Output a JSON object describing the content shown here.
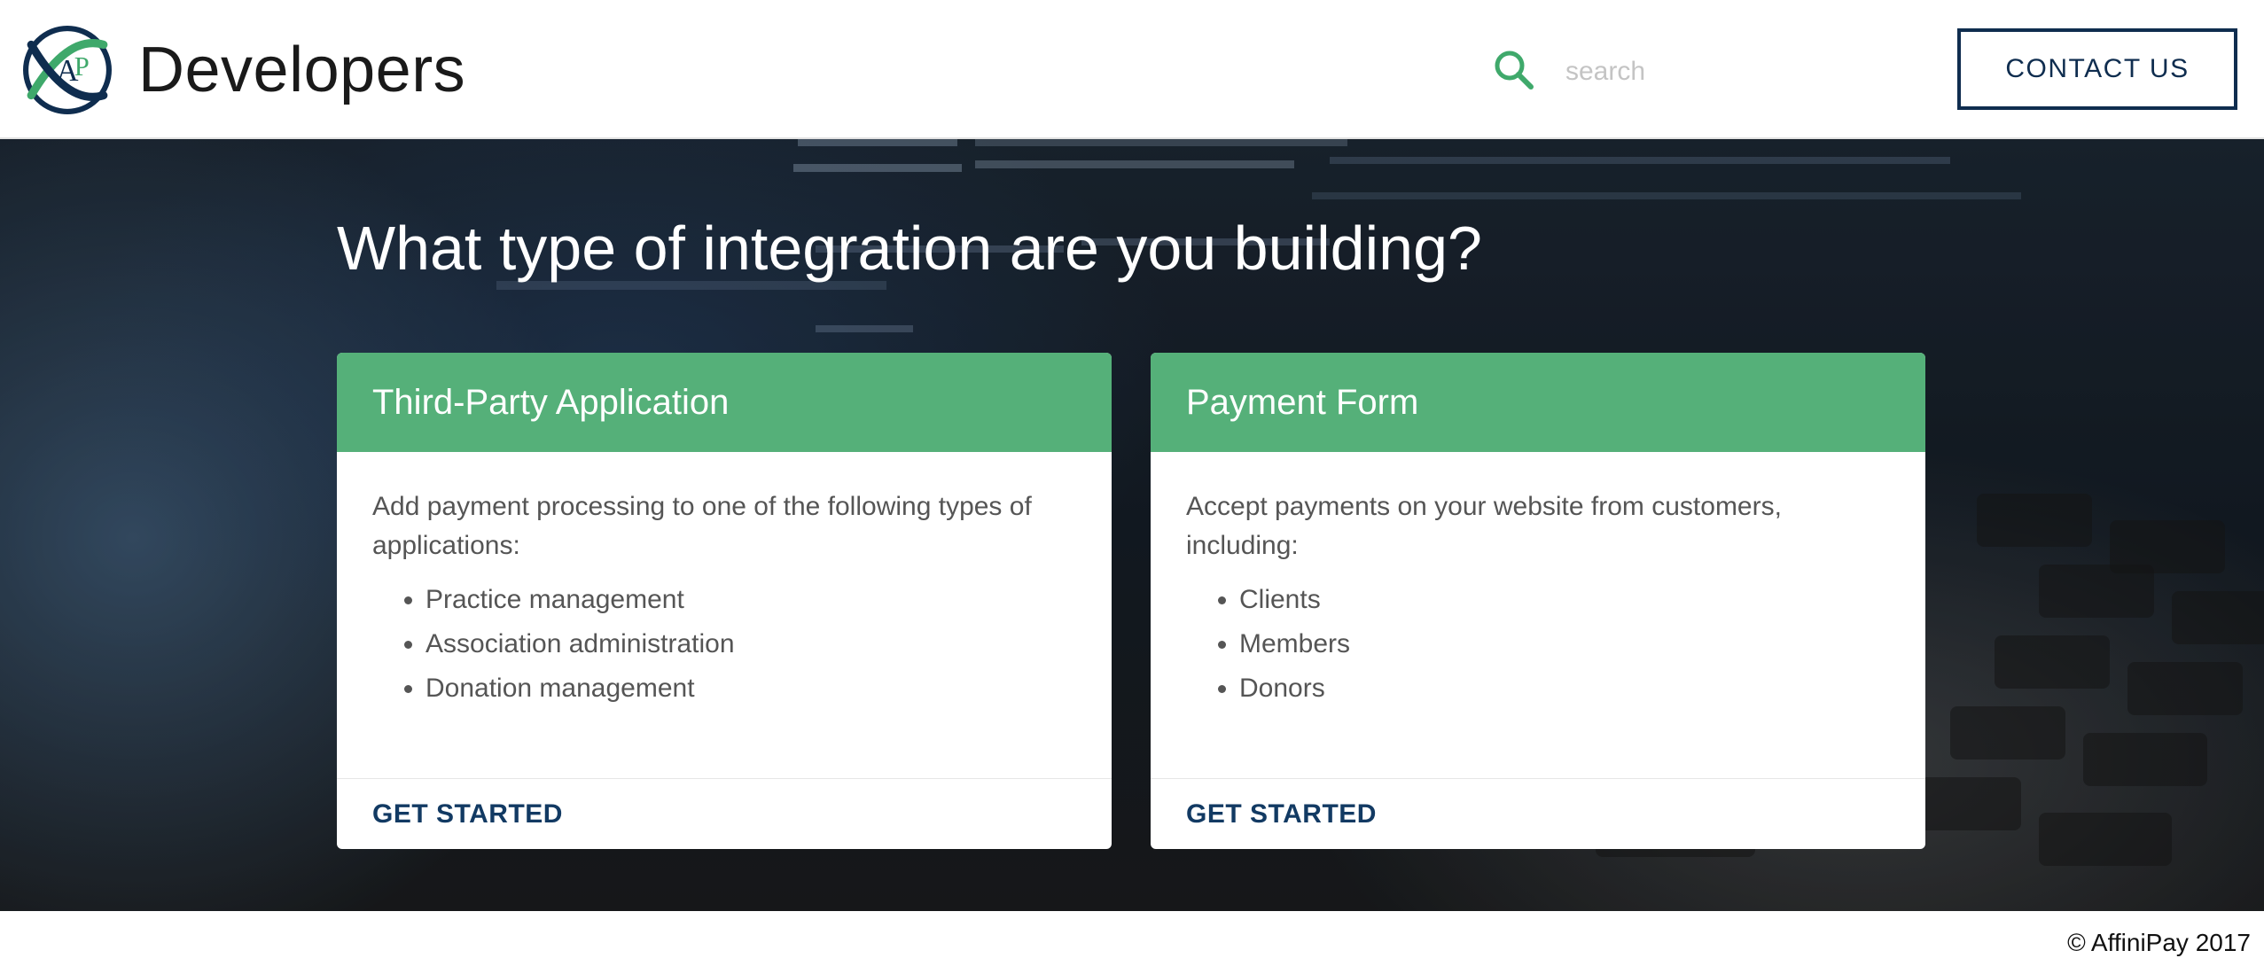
{
  "header": {
    "logo_icon": "affinipay-logo-icon",
    "brand": "Developers",
    "search": {
      "icon": "search-icon",
      "placeholder": "search",
      "value": ""
    },
    "contact_button": "CONTACT US"
  },
  "hero": {
    "title": "What type of integration are you building?",
    "cards": [
      {
        "title": "Third-Party Application",
        "description": "Add payment processing to one of the following types of applications:",
        "items": [
          "Practice management",
          "Association administration",
          "Donation management"
        ],
        "cta": "GET STARTED"
      },
      {
        "title": "Payment Form",
        "description": "Accept payments on your website from customers, including:",
        "items": [
          "Clients",
          "Members",
          "Donors"
        ],
        "cta": "GET STARTED"
      }
    ]
  },
  "footer": {
    "copyright": "© AffiniPay 2017"
  },
  "colors": {
    "accent_green": "#55b079",
    "navy": "#0f2d4f",
    "link_navy": "#123a63"
  }
}
